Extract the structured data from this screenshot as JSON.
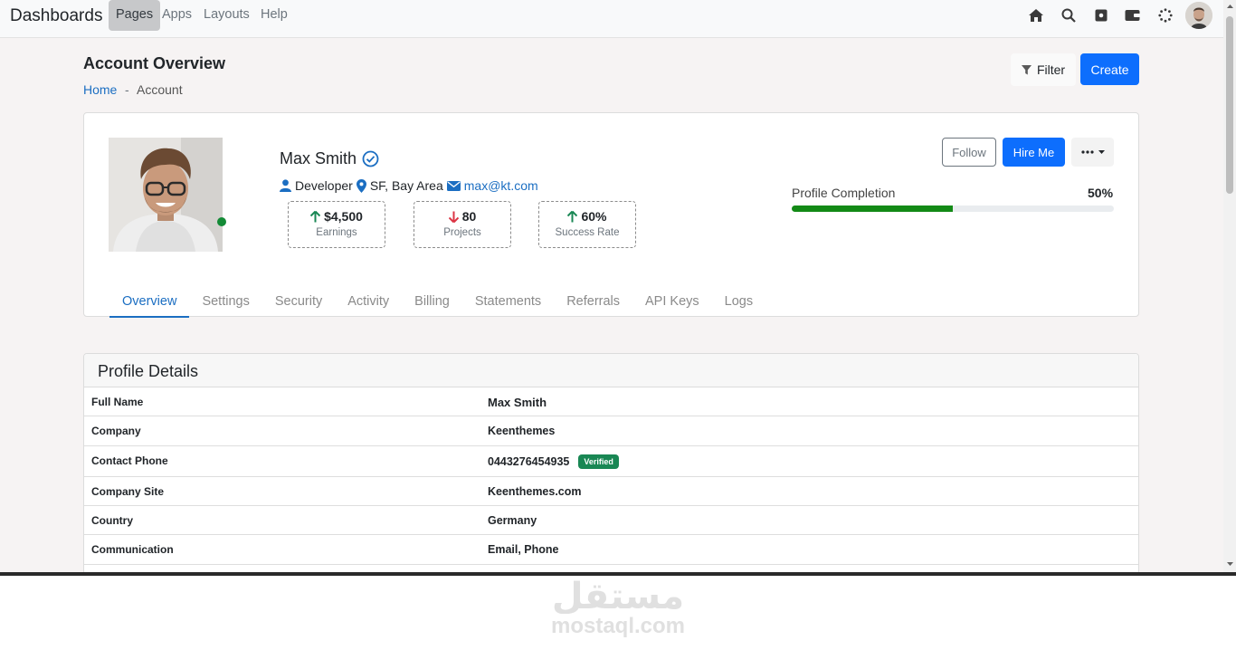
{
  "topnav": {
    "brand": "Dashboards",
    "links": [
      "Pages",
      "Apps",
      "Layouts",
      "Help"
    ],
    "active_link": "Pages",
    "icons": [
      "home-icon",
      "search-icon",
      "record-icon",
      "wallet-icon",
      "loader-icon",
      "avatar"
    ]
  },
  "page": {
    "title": "Account Overview",
    "breadcrumb": {
      "home": "Home",
      "separator": "-",
      "current": "Account"
    },
    "filter_label": "Filter",
    "create_label": "Create"
  },
  "profile": {
    "name": "Max Smith",
    "role": "Developer",
    "location": "SF, Bay Area",
    "email": "max@kt.com",
    "stats": [
      {
        "value": "$4,500",
        "label": "Earnings",
        "trend": "up"
      },
      {
        "value": "80",
        "label": "Projects",
        "trend": "down"
      },
      {
        "value": "60%",
        "label": "Success Rate",
        "trend": "up"
      }
    ],
    "follow_label": "Follow",
    "hire_label": "Hire Me",
    "completion_label": "Profile Completion",
    "completion_value": "50%",
    "completion_fraction": 0.5
  },
  "tabs": [
    "Overview",
    "Settings",
    "Security",
    "Activity",
    "Billing",
    "Statements",
    "Referrals",
    "API Keys",
    "Logs"
  ],
  "active_tab": "Overview",
  "details": {
    "title": "Profile Details",
    "rows": [
      {
        "label": "Full Name",
        "value": "Max Smith"
      },
      {
        "label": "Company",
        "value": "Keenthemes"
      },
      {
        "label": "Contact Phone",
        "value": "0443276454935",
        "badge": "Verified"
      },
      {
        "label": "Company Site",
        "value": "Keenthemes.com"
      },
      {
        "label": "Country",
        "value": "Germany"
      },
      {
        "label": "Communication",
        "value": "Email, Phone"
      }
    ]
  },
  "watermark": {
    "arabic": "مستقل",
    "latin": "mostaql.com"
  },
  "colors": {
    "primary": "#0d6efd",
    "link": "#1b6ec2",
    "progress": "#138a16",
    "online": "#138a36",
    "verified": "#198754",
    "up_arrow": "#198754",
    "down_arrow": "#dc3545"
  }
}
